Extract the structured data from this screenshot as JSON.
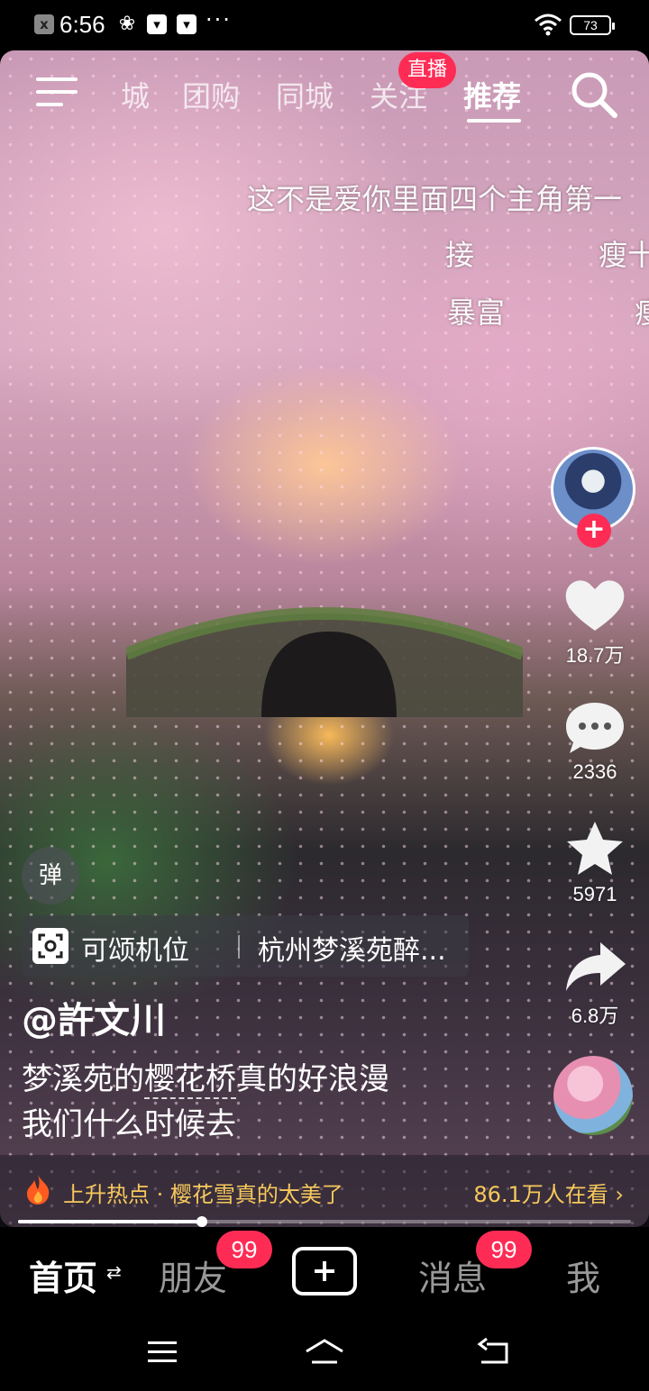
{
  "status_bar": {
    "time": "6:56",
    "battery": "73",
    "notif_icons": [
      "x",
      "❀",
      "▾",
      "▾"
    ],
    "more": "···"
  },
  "top_nav": {
    "tabs": [
      "城",
      "团购",
      "同城",
      "关注",
      "推荐"
    ],
    "active_tab": "推荐",
    "live_badge": "直播",
    "icons": [
      "menu-icon",
      "search-icon"
    ]
  },
  "danmaku": [
    "这不是爱你里面四个主角第一",
    "接",
    "瘦十",
    "暴富",
    "瘦"
  ],
  "right_rail": {
    "like_count": "18.7万",
    "comment_count": "2336",
    "favorite_count": "5971",
    "share_count": "6.8万",
    "follow_icon": "+"
  },
  "overlay": {
    "danmu_toggle": "弹",
    "poi_label": "可颂机位",
    "poi_name": "杭州梦溪苑醉...",
    "author": "@許文川",
    "caption_line1_pre": "梦溪苑的",
    "caption_keyword": "樱花桥",
    "caption_line1_post": "真的好浪漫",
    "caption_line2": "我们什么时候去"
  },
  "hot_bar": {
    "text": "上升热点 · 樱花雪真的太美了",
    "viewers": "86.1万人在看 ›"
  },
  "progress": {
    "fraction": 0.3
  },
  "tab_bar": {
    "home": "首页",
    "home_switch": "⇄",
    "friends": "朋友",
    "friends_badge": "99",
    "messages": "消息",
    "messages_badge": "99",
    "me": "我"
  },
  "colors": {
    "accent": "#fe2c55",
    "hot_text": "#f7c95b"
  }
}
